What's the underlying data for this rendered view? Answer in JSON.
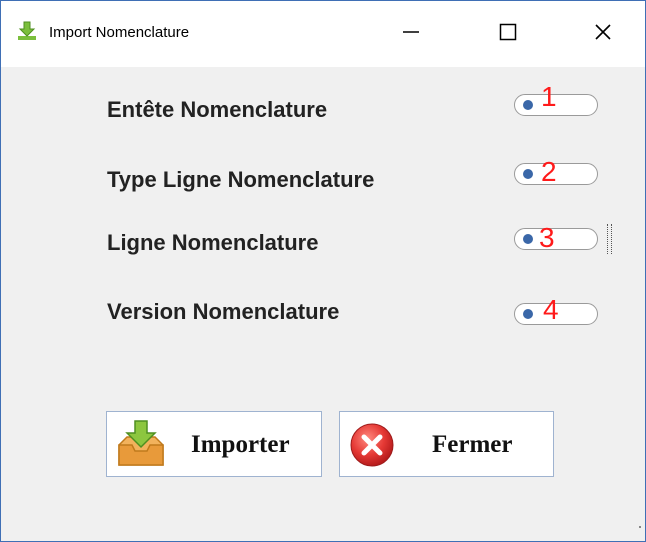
{
  "window": {
    "title": "Import Nomenclature",
    "app_icon": "import-down-arrow-icon",
    "controls": [
      "minimize-icon",
      "maximize-icon",
      "close-icon"
    ]
  },
  "rows": [
    {
      "label": "Entête Nomenclature",
      "marker": "1",
      "toggle_on": false
    },
    {
      "label": "Type Ligne Nomenclature",
      "marker": "2",
      "toggle_on": false
    },
    {
      "label": "Ligne Nomenclature",
      "marker": "3",
      "toggle_on": false
    },
    {
      "label": "Version Nomenclature",
      "marker": "4",
      "toggle_on": false
    }
  ],
  "buttons": {
    "import": {
      "label": "Importer",
      "icon": "inbox-download-icon"
    },
    "close": {
      "label": "Fermer",
      "icon": "red-x-circle-icon"
    }
  },
  "colors": {
    "window_border": "#3f6fb5",
    "toggle_knob": "#3a67a8",
    "marker_red": "#ff1a1a"
  }
}
